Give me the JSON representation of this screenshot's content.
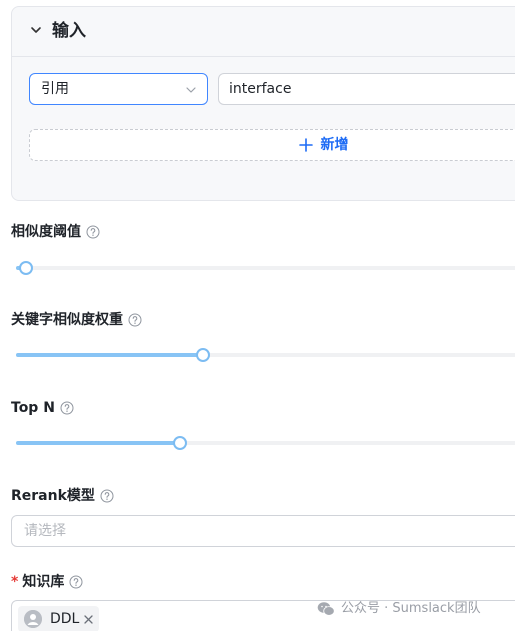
{
  "input_panel": {
    "title": "输入",
    "ref_select": {
      "value": "引用"
    },
    "param_input": {
      "value": "interface"
    },
    "add_label": "新增"
  },
  "similarity": {
    "label": "相似度阈值",
    "value_fraction": 0.02
  },
  "keyword_weight": {
    "label": "关键字相似度权重",
    "value_fraction": 0.37
  },
  "top_n": {
    "label": "Top N",
    "value_fraction": 0.325
  },
  "rerank": {
    "label": "Rerank模型",
    "placeholder": "请选择"
  },
  "knowledge_base": {
    "required_mark": "*",
    "label": "知识库",
    "tags": [
      "DDL"
    ]
  },
  "watermark": {
    "text": "公众号 · Sumslack团队"
  },
  "colors": {
    "accent": "#1e6cf5",
    "slider_fill": "#88c4f5",
    "required": "#e53935"
  }
}
